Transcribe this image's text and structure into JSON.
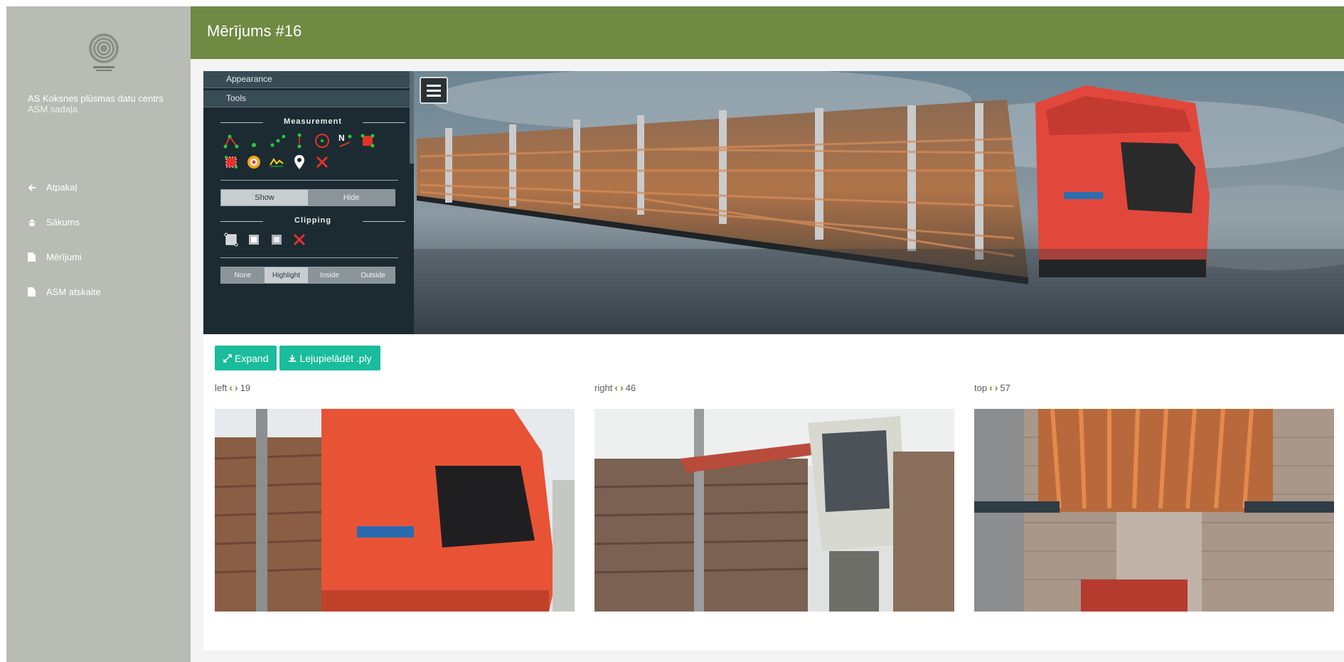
{
  "org": {
    "name": "AS Koksnes plūsmas datu centrs",
    "section": "ASM sadaļa"
  },
  "nav": [
    {
      "label": "Atpakaļ",
      "icon": "arrow-left-icon"
    },
    {
      "label": "Sākums",
      "icon": "home-icon"
    },
    {
      "label": "Mērījumi",
      "icon": "document-icon"
    },
    {
      "label": "ASM atskaite",
      "icon": "document-icon"
    }
  ],
  "header": {
    "title": "Mērījums #16"
  },
  "viewer_sidebar": {
    "accordion": [
      "Appearance",
      "Tools"
    ],
    "measurement_title": "Measurement",
    "show_hide": {
      "show": "Show",
      "hide": "Hide",
      "active": "Show"
    },
    "clipping_title": "Clipping",
    "clip_modes": {
      "options": [
        "None",
        "Highlight",
        "Inside",
        "Outside"
      ],
      "active": "Highlight"
    }
  },
  "actions": {
    "expand": "Expand",
    "download": "Lejupielādēt .ply"
  },
  "cameras": [
    {
      "name": "left",
      "count": "19"
    },
    {
      "name": "right",
      "count": "46"
    },
    {
      "name": "top",
      "count": "57"
    }
  ],
  "colors": {
    "header": "#6e8a43",
    "sidebar": "#b9bbb5",
    "accent": "#1abc9c",
    "viewer_panel": "#1c2b31"
  }
}
